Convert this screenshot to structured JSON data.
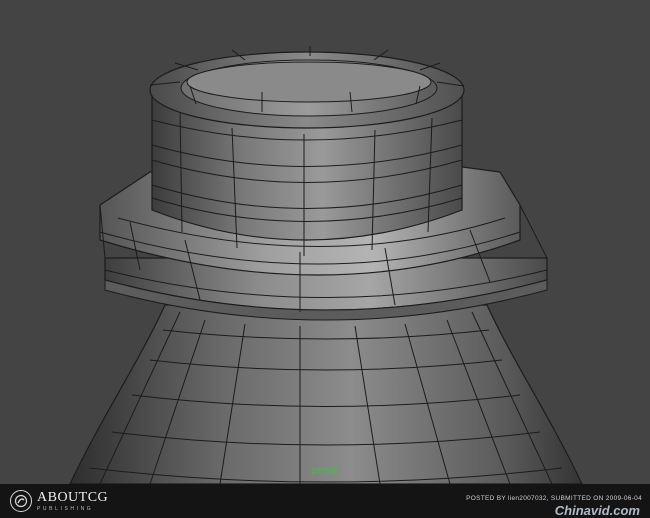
{
  "viewport": {
    "camera_label": "persp",
    "background_color": "#444444",
    "wire_color": "#1c1c1c",
    "shape": "lathe-polygon-mesh"
  },
  "footer": {
    "brand_name": "ABOUTCG",
    "brand_sub": "PUBLISHING",
    "brand_icon": "camera-lens-icon",
    "credit": "POSTED BY lien2007032, SUBMITTED ON 2009-06-04"
  },
  "watermark": "Chinavid.com"
}
